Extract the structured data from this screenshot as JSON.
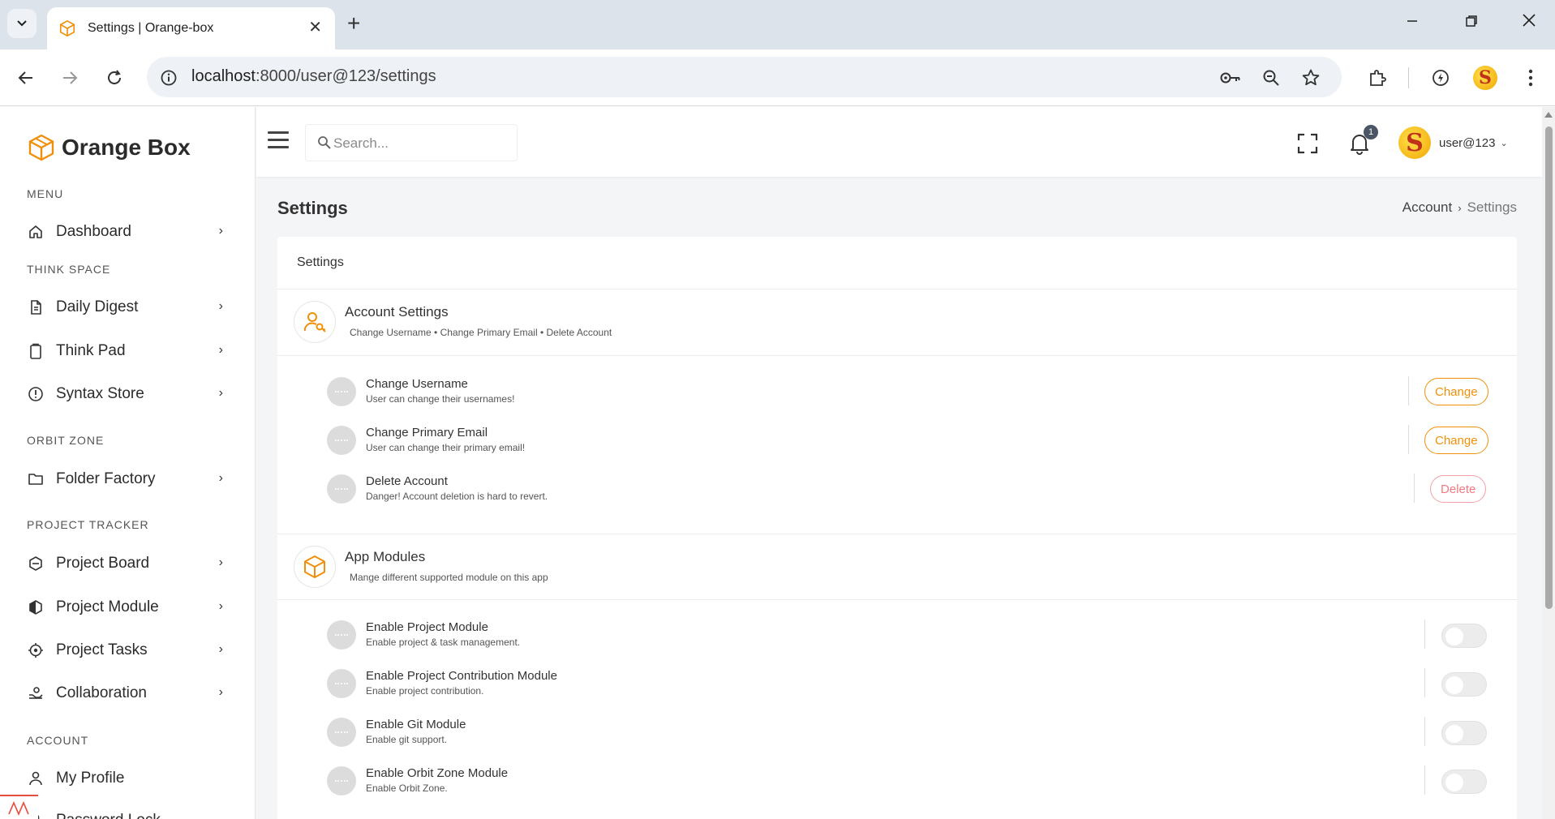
{
  "browser": {
    "tab_title": "Settings | Orange-box",
    "url_host": "localhost",
    "url_rest": ":8000/user@123/settings",
    "colors": {
      "tabstrip": "#dde3ea",
      "accent": "#f0900a"
    }
  },
  "sidebar": {
    "brand": "Orange Box",
    "sections": [
      {
        "heading": "MENU",
        "items": [
          {
            "label": "Dashboard",
            "icon": "home-icon"
          }
        ]
      },
      {
        "heading": "THINK SPACE",
        "items": [
          {
            "label": "Daily Digest",
            "icon": "document-icon"
          },
          {
            "label": "Think Pad",
            "icon": "clipboard-icon"
          },
          {
            "label": "Syntax Store",
            "icon": "alert-circle-icon"
          }
        ]
      },
      {
        "heading": "ORBIT ZONE",
        "items": [
          {
            "label": "Folder Factory",
            "icon": "folder-icon"
          }
        ]
      },
      {
        "heading": "PROJECT TRACKER",
        "items": [
          {
            "label": "Project Board",
            "icon": "hexagon-icon"
          },
          {
            "label": "Project Module",
            "icon": "hexagon-half-icon"
          },
          {
            "label": "Project Tasks",
            "icon": "target-icon"
          },
          {
            "label": "Collaboration",
            "icon": "hand-share-icon"
          }
        ]
      },
      {
        "heading": "ACCOUNT",
        "items": [
          {
            "label": "My Profile",
            "icon": "user-icon"
          },
          {
            "label": "Password Lock",
            "icon": "lock-icon"
          }
        ]
      }
    ]
  },
  "topbar": {
    "search_placeholder": "Search...",
    "notification_count": "1",
    "user_initial": "S",
    "username": "user@123"
  },
  "page": {
    "title": "Settings",
    "breadcrumb": [
      "Account",
      "Settings"
    ]
  },
  "card": {
    "title": "Settings",
    "account_settings": {
      "title": "Account Settings",
      "subtitle": "Change Username • Change Primary Email • Delete Account",
      "rows": [
        {
          "title": "Change Username",
          "desc": "User can change their usernames!",
          "action": "Change"
        },
        {
          "title": "Change Primary Email",
          "desc": "User can change their primary email!",
          "action": "Change"
        },
        {
          "title": "Delete Account",
          "desc": "Danger! Account deletion is hard to revert.",
          "action": "Delete"
        }
      ]
    },
    "app_modules": {
      "title": "App Modules",
      "subtitle": "Mange different supported module on this app",
      "rows": [
        {
          "title": "Enable Project Module",
          "desc": "Enable project & task management.",
          "enabled": false
        },
        {
          "title": "Enable Project Contribution Module",
          "desc": "Enable project contribution.",
          "enabled": false
        },
        {
          "title": "Enable Git Module",
          "desc": "Enable git support.",
          "enabled": false
        },
        {
          "title": "Enable Orbit Zone Module",
          "desc": "Enable Orbit Zone.",
          "enabled": false
        }
      ]
    }
  }
}
